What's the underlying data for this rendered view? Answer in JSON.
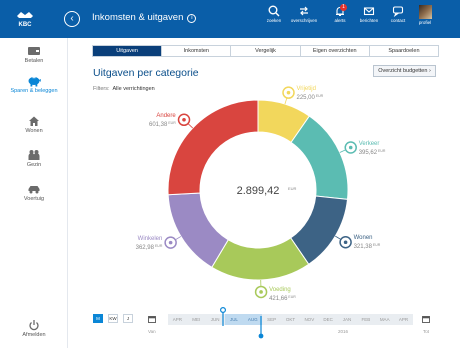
{
  "app": {
    "title": "Inkomsten & uitgaven"
  },
  "topbar": {
    "actions": [
      {
        "label": "zoeken",
        "icon": "search-icon"
      },
      {
        "label": "overschrijven",
        "icon": "transfer-icon"
      },
      {
        "label": "alerts",
        "icon": "bell-icon",
        "badge": "1"
      },
      {
        "label": "berichten",
        "icon": "mail-icon"
      },
      {
        "label": "contact",
        "icon": "chat-icon"
      },
      {
        "label": "profiel",
        "icon": "avatar"
      }
    ]
  },
  "sidenav": {
    "items": [
      {
        "label": "Betalen",
        "icon": "wallet-icon"
      },
      {
        "label": "Sparen & beleggen",
        "icon": "piggy-bank-icon"
      },
      {
        "label": "Wonen",
        "icon": "house-icon"
      },
      {
        "label": "Gezin",
        "icon": "family-icon"
      },
      {
        "label": "Voertuig",
        "icon": "car-icon"
      },
      {
        "label": "Afmelden",
        "icon": "power-icon"
      }
    ]
  },
  "tabs": [
    "Uitgaven",
    "Inkomsten",
    "Vergelijk",
    "Eigen overzichten",
    "Spaardoelen"
  ],
  "main": {
    "section_title": "Uitgaven per categorie",
    "overview_button": "Overzicht budgetten  ›",
    "filter_label": "Filters:",
    "filter_value": "Alle verrichtingen"
  },
  "chart_data": {
    "type": "pie",
    "donut": true,
    "center_total": "2.899,42",
    "center_total_cents": "EUR",
    "slices": [
      {
        "name": "Vrije tijd",
        "label": "Vrijetijd",
        "amount": "225,00",
        "value": 225.0,
        "color": "#f2d75c",
        "icon": "bulb-icon"
      },
      {
        "name": "Verkeer",
        "label": "Verkeer",
        "amount": "395,62",
        "value": 395.62,
        "color": "#5bbcb2",
        "icon": "car-icon"
      },
      {
        "name": "Wonen",
        "label": "Wonen",
        "amount": "321,38",
        "value": 321.38,
        "color": "#3d6385",
        "icon": "house-icon"
      },
      {
        "name": "Voeding",
        "label": "Voeding",
        "amount": "421,66",
        "value": 421.66,
        "color": "#a8c95a",
        "icon": "food-icon"
      },
      {
        "name": "Winkelen",
        "label": "Winkelen",
        "amount": "362,98",
        "value": 362.98,
        "color": "#9b8ac4",
        "icon": "cart-icon"
      },
      {
        "name": "Andere",
        "label": "Andere",
        "amount": "601,38",
        "value": 601.38,
        "color": "#d9453f",
        "icon": "search-icon"
      }
    ]
  },
  "timeline": {
    "controls": [
      "M",
      "KW",
      "J"
    ],
    "months": [
      "APR",
      "MEI",
      "JUN",
      "JUL",
      "AUG",
      "SEP",
      "OKT",
      "NOV",
      "DEC",
      "JAN",
      "FEB",
      "MAA",
      "APR"
    ],
    "selected_month": "AUG",
    "year_label": "2016",
    "start_label": "Van",
    "end_label": "Tot"
  },
  "colors": {
    "brand": "#0a5ea8",
    "accent": "#0a86d6"
  }
}
